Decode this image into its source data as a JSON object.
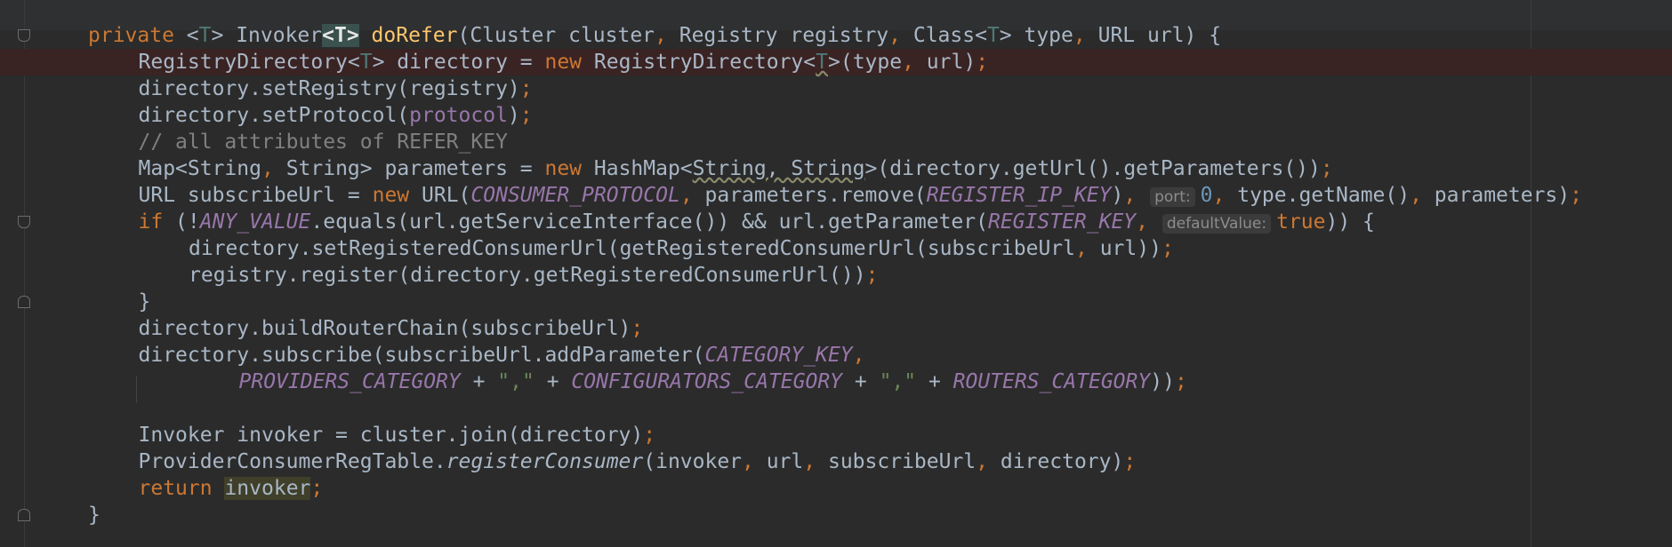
{
  "editor": {
    "language": "Java",
    "theme": "Darcula",
    "colors": {
      "background": "#2b2b2b",
      "keyword": "#cc7832",
      "method": "#ffc66d",
      "constant": "#9876aa",
      "string": "#6a8759",
      "number": "#6897bb",
      "comment": "#808080",
      "error_line": "#3a2323"
    },
    "lines": [
      {
        "indent": 1,
        "tokens": [
          {
            "t": "private",
            "c": "k"
          },
          {
            "t": " <"
          },
          {
            "t": "T",
            "c": "tp"
          },
          {
            "t": "> Invoker"
          },
          {
            "t": "<T>",
            "c": "tpb"
          },
          {
            "t": " "
          },
          {
            "t": "doRefer",
            "c": "f"
          },
          {
            "t": "(Cluster cluster"
          },
          {
            "t": ",",
            "c": "k"
          },
          {
            "t": " Registry registry"
          },
          {
            "t": ",",
            "c": "k"
          },
          {
            "t": " Class<"
          },
          {
            "t": "T",
            "c": "tp"
          },
          {
            "t": "> type"
          },
          {
            "t": ",",
            "c": "k"
          },
          {
            "t": " URL url) {"
          }
        ]
      },
      {
        "indent": 2,
        "highlight": true,
        "tokens": [
          {
            "t": "RegistryDirectory<"
          },
          {
            "t": "T",
            "c": "tp"
          },
          {
            "t": "> directory = "
          },
          {
            "t": "new",
            "c": "k"
          },
          {
            "t": " RegistryDirectory<"
          },
          {
            "t": "T",
            "c": "tp uw"
          },
          {
            "t": ">(type"
          },
          {
            "t": ",",
            "c": "k"
          },
          {
            "t": " url)"
          },
          {
            "t": ";",
            "c": "k"
          }
        ]
      },
      {
        "indent": 2,
        "tokens": [
          {
            "t": "directory.setRegistry(registry)"
          },
          {
            "t": ";",
            "c": "k"
          }
        ]
      },
      {
        "indent": 2,
        "tokens": [
          {
            "t": "directory.setProtocol("
          },
          {
            "t": "protocol",
            "c": "fld"
          },
          {
            "t": ")"
          },
          {
            "t": ";",
            "c": "k"
          }
        ]
      },
      {
        "indent": 2,
        "tokens": [
          {
            "t": "// all attributes of REFER_KEY",
            "c": "cm"
          }
        ]
      },
      {
        "indent": 2,
        "tokens": [
          {
            "t": "Map<String"
          },
          {
            "t": ",",
            "c": "k"
          },
          {
            "t": " String> parameters = "
          },
          {
            "t": "new",
            "c": "k"
          },
          {
            "t": " HashMap<"
          },
          {
            "t": "String, String",
            "c": "uw"
          },
          {
            "t": ">(directory.getUrl().getParameters())"
          },
          {
            "t": ";",
            "c": "k"
          }
        ]
      },
      {
        "indent": 2,
        "tokens": [
          {
            "t": "URL subscribeUrl = "
          },
          {
            "t": "new",
            "c": "k"
          },
          {
            "t": " URL("
          },
          {
            "t": "CONSUMER_PROTOCOL",
            "c": "c"
          },
          {
            "t": ",",
            "c": "k"
          },
          {
            "t": " parameters.remove("
          },
          {
            "t": "REGISTER_IP_KEY",
            "c": "c"
          },
          {
            "t": ")"
          },
          {
            "t": ",",
            "c": "k"
          },
          {
            "t": " "
          },
          {
            "t": "port:",
            "c": "hint"
          },
          {
            "t": "0",
            "c": "n"
          },
          {
            "t": ",",
            "c": "k"
          },
          {
            "t": " type.getName()"
          },
          {
            "t": ",",
            "c": "k"
          },
          {
            "t": " parameters)"
          },
          {
            "t": ";",
            "c": "k"
          }
        ]
      },
      {
        "indent": 2,
        "tokens": [
          {
            "t": "if",
            "c": "k"
          },
          {
            "t": " (!"
          },
          {
            "t": "ANY_VALUE",
            "c": "c"
          },
          {
            "t": ".equals(url.getServiceInterface()) && url.getParameter("
          },
          {
            "t": "REGISTER_KEY",
            "c": "c"
          },
          {
            "t": ",",
            "c": "k"
          },
          {
            "t": " "
          },
          {
            "t": "defaultValue:",
            "c": "hint"
          },
          {
            "t": "true",
            "c": "k"
          },
          {
            "t": ")) {"
          }
        ]
      },
      {
        "indent": 3,
        "tokens": [
          {
            "t": "directory.setRegisteredConsumerUrl(getRegisteredConsumerUrl(subscribeUrl"
          },
          {
            "t": ",",
            "c": "k"
          },
          {
            "t": " url))"
          },
          {
            "t": ";",
            "c": "k"
          }
        ]
      },
      {
        "indent": 3,
        "tokens": [
          {
            "t": "registry.register(directory.getRegisteredConsumerUrl())"
          },
          {
            "t": ";",
            "c": "k"
          }
        ]
      },
      {
        "indent": 2,
        "tokens": [
          {
            "t": "}"
          }
        ]
      },
      {
        "indent": 2,
        "tokens": [
          {
            "t": "directory.buildRouterChain(subscribeUrl)"
          },
          {
            "t": ";",
            "c": "k"
          }
        ]
      },
      {
        "indent": 2,
        "tokens": [
          {
            "t": "directory.subscribe(subscribeUrl.addParameter("
          },
          {
            "t": "CATEGORY_KEY",
            "c": "c"
          },
          {
            "t": ",",
            "c": "k"
          }
        ]
      },
      {
        "indent": 4,
        "tokens": [
          {
            "t": "PROVIDERS_CATEGORY",
            "c": "c"
          },
          {
            "t": " + "
          },
          {
            "t": "\",\"",
            "c": "s"
          },
          {
            "t": " + "
          },
          {
            "t": "CONFIGURATORS_CATEGORY",
            "c": "c"
          },
          {
            "t": " + "
          },
          {
            "t": "\",\"",
            "c": "s"
          },
          {
            "t": " + "
          },
          {
            "t": "ROUTERS_CATEGORY",
            "c": "c"
          },
          {
            "t": "))"
          },
          {
            "t": ";",
            "c": "k"
          }
        ]
      },
      {
        "indent": 0,
        "tokens": []
      },
      {
        "indent": 2,
        "tokens": [
          {
            "t": "Invoker invoker = cluster.join(directory)"
          },
          {
            "t": ";",
            "c": "k"
          }
        ]
      },
      {
        "indent": 2,
        "tokens": [
          {
            "t": "ProviderConsumerRegTable."
          },
          {
            "t": "registerConsumer",
            "c": "it"
          },
          {
            "t": "(invoker"
          },
          {
            "t": ",",
            "c": "k"
          },
          {
            "t": " url"
          },
          {
            "t": ",",
            "c": "k"
          },
          {
            "t": " subscribeUrl"
          },
          {
            "t": ",",
            "c": "k"
          },
          {
            "t": " directory)"
          },
          {
            "t": ";",
            "c": "k"
          }
        ]
      },
      {
        "indent": 2,
        "tokens": [
          {
            "t": "return",
            "c": "k"
          },
          {
            "t": " "
          },
          {
            "t": "invoker",
            "c": "ret"
          },
          {
            "t": ";",
            "c": "k"
          }
        ]
      },
      {
        "indent": 1,
        "tokens": [
          {
            "t": "}"
          }
        ]
      }
    ],
    "fold_markers": [
      {
        "line": 0,
        "kind": "open",
        "icon": "fold-open-icon"
      },
      {
        "line": 7,
        "kind": "open",
        "icon": "fold-open-icon"
      },
      {
        "line": 10,
        "kind": "close",
        "icon": "fold-close-icon"
      },
      {
        "line": 18,
        "kind": "close",
        "icon": "fold-close-icon"
      }
    ]
  }
}
